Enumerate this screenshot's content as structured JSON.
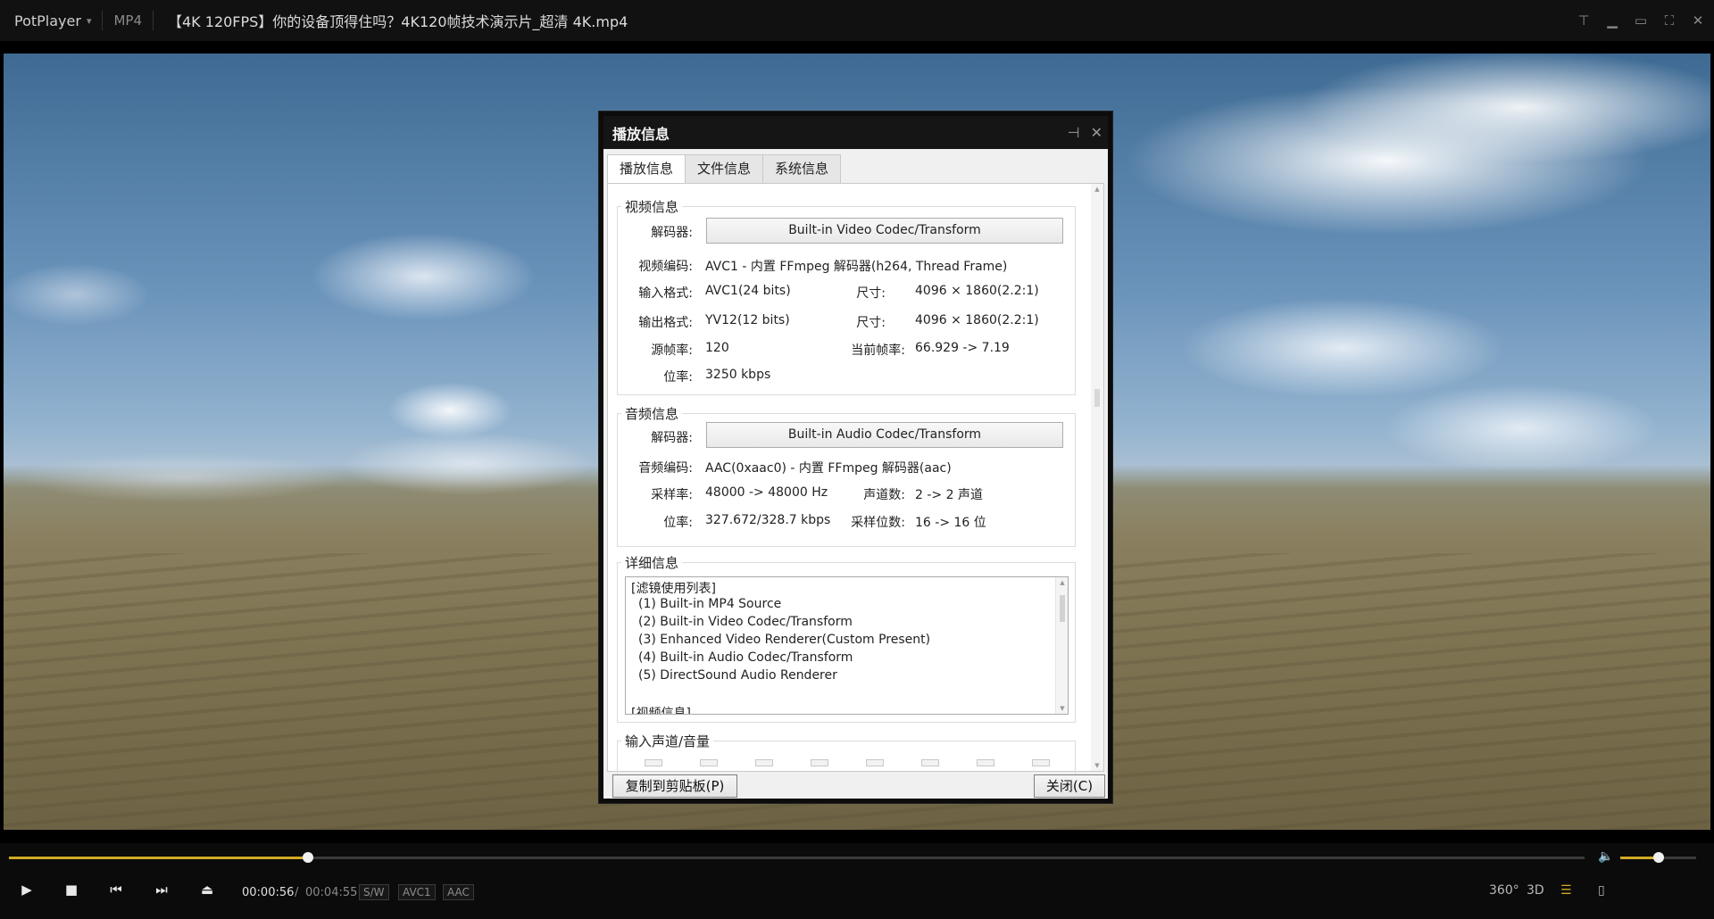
{
  "titlebar": {
    "app_name": "PotPlayer",
    "format": "MP4",
    "file_title": "【4K 120FPS】你的设备顶得住吗？4K120帧技术演示片_超清 4K.mp4"
  },
  "dialog": {
    "title": "播放信息",
    "tabs": [
      "播放信息",
      "文件信息",
      "系统信息"
    ],
    "video": {
      "section": "视频信息",
      "decoder_label": "解码器:",
      "decoder_value": "Built-in Video Codec/Transform",
      "codec_label": "视频编码:",
      "codec_value": "AVC1 - 内置 FFmpeg 解码器(h264, Thread Frame)",
      "input_label": "输入格式:",
      "input_value": "AVC1(24 bits)",
      "input_size_label": "尺寸:",
      "input_size_value": "4096 × 1860(2.2:1)",
      "output_label": "输出格式:",
      "output_value": "YV12(12 bits)",
      "output_size_label": "尺寸:",
      "output_size_value": "4096 × 1860(2.2:1)",
      "src_fps_label": "源帧率:",
      "src_fps_value": "120",
      "cur_fps_label": "当前帧率:",
      "cur_fps_value": "66.929 -> 7.19",
      "bitrate_label": "位率:",
      "bitrate_value": "3250 kbps"
    },
    "audio": {
      "section": "音频信息",
      "decoder_label": "解码器:",
      "decoder_value": "Built-in Audio Codec/Transform",
      "codec_label": "音频编码:",
      "codec_value": "AAC(0xaac0) - 内置 FFmpeg 解码器(aac)",
      "samplerate_label": "采样率:",
      "samplerate_value": "48000 -> 48000 Hz",
      "channels_label": "声道数:",
      "channels_value": "2 -> 2 声道",
      "bitrate_label": "位率:",
      "bitrate_value": "327.672/328.7 kbps",
      "bits_label": "采样位数:",
      "bits_value": "16 -> 16 位"
    },
    "details": {
      "section": "详细信息",
      "lines": [
        "[滤镜使用列表]",
        "  (1) Built-in MP4 Source",
        "  (2) Built-in Video Codec/Transform",
        "  (3) Enhanced Video Renderer(Custom Present)",
        "  (4) Built-in Audio Codec/Transform",
        "  (5) DirectSound Audio Renderer",
        "[视频信息]"
      ]
    },
    "channels_section": "输入声道/音量",
    "copy_button": "复制到剪贴板(P)",
    "close_button": "关闭(C)"
  },
  "player": {
    "current_time": "00:00:56",
    "time_sep": "/",
    "total_time": "00:04:55",
    "progress_fraction": 0.19,
    "volume_fraction": 0.5,
    "badges": [
      "S/W",
      "AVC1",
      "AAC"
    ],
    "right_buttons": [
      "360°",
      "3D"
    ],
    "accent_color": "#d2aa24"
  }
}
